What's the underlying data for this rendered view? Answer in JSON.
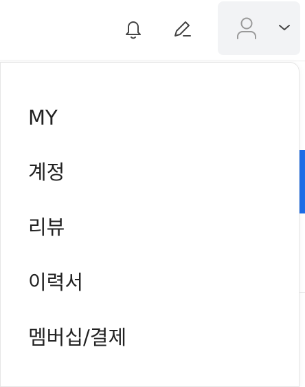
{
  "header": {
    "icons": {
      "notification": "bell-icon",
      "write": "pencil-icon",
      "profile": "user-icon",
      "dropdown_toggle": "chevron-down-icon"
    }
  },
  "dropdown": {
    "items": [
      {
        "label": "MY"
      },
      {
        "label": "계정"
      },
      {
        "label": "리뷰"
      },
      {
        "label": "이력서"
      },
      {
        "label": "멤버십/결제"
      }
    ]
  },
  "colors": {
    "accent_blue": "#1e6ee8",
    "text": "#222222",
    "icon": "#444444",
    "profile_bg": "#f2f3f5"
  }
}
